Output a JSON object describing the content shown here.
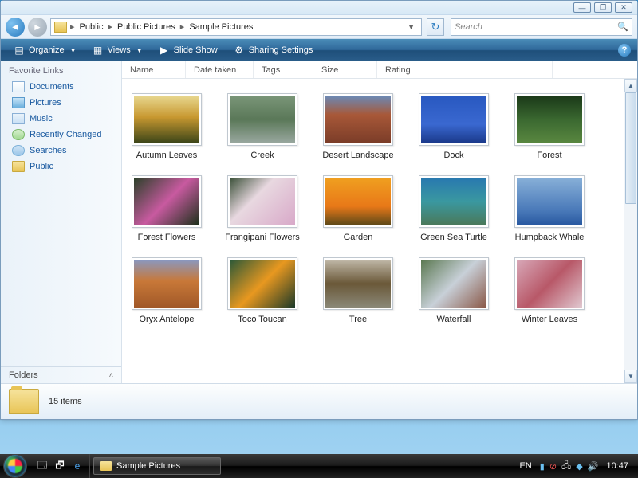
{
  "titlebar": {
    "min": "—",
    "max": "❐",
    "close": "✕"
  },
  "nav": {
    "breadcrumb": [
      "Public",
      "Public Pictures",
      "Sample Pictures"
    ],
    "refresh": "↻",
    "search_placeholder": "Search"
  },
  "toolbar": {
    "organize": "Organize",
    "views": "Views",
    "slideshow": "Slide Show",
    "sharing": "Sharing Settings",
    "help": "?"
  },
  "favlinks": {
    "header": "Favorite Links",
    "items": [
      {
        "label": "Documents",
        "icon": "ico-doc"
      },
      {
        "label": "Pictures",
        "icon": "ico-pic"
      },
      {
        "label": "Music",
        "icon": "ico-mus"
      },
      {
        "label": "Recently Changed",
        "icon": "ico-rec"
      },
      {
        "label": "Searches",
        "icon": "ico-sea"
      },
      {
        "label": "Public",
        "icon": "ico-pub"
      }
    ],
    "folders": "Folders"
  },
  "columns": [
    "Name",
    "Date taken",
    "Tags",
    "Size",
    "Rating"
  ],
  "items": [
    {
      "label": "Autumn Leaves",
      "g": "g-autumn"
    },
    {
      "label": "Creek",
      "g": "g-creek"
    },
    {
      "label": "Desert Landscape",
      "g": "g-desert"
    },
    {
      "label": "Dock",
      "g": "g-dock"
    },
    {
      "label": "Forest",
      "g": "g-forest"
    },
    {
      "label": "Forest Flowers",
      "g": "g-fflowers"
    },
    {
      "label": "Frangipani Flowers",
      "g": "g-frangipani"
    },
    {
      "label": "Garden",
      "g": "g-garden"
    },
    {
      "label": "Green Sea Turtle",
      "g": "g-turtle"
    },
    {
      "label": "Humpback Whale",
      "g": "g-whale"
    },
    {
      "label": "Oryx Antelope",
      "g": "g-oryx"
    },
    {
      "label": "Toco Toucan",
      "g": "g-toucan"
    },
    {
      "label": "Tree",
      "g": "g-tree"
    },
    {
      "label": "Waterfall",
      "g": "g-waterfall"
    },
    {
      "label": "Winter Leaves",
      "g": "g-winter"
    }
  ],
  "details": {
    "count": "15 items"
  },
  "taskbar": {
    "task": "Sample Pictures",
    "lang": "EN",
    "clock": "10:47"
  }
}
